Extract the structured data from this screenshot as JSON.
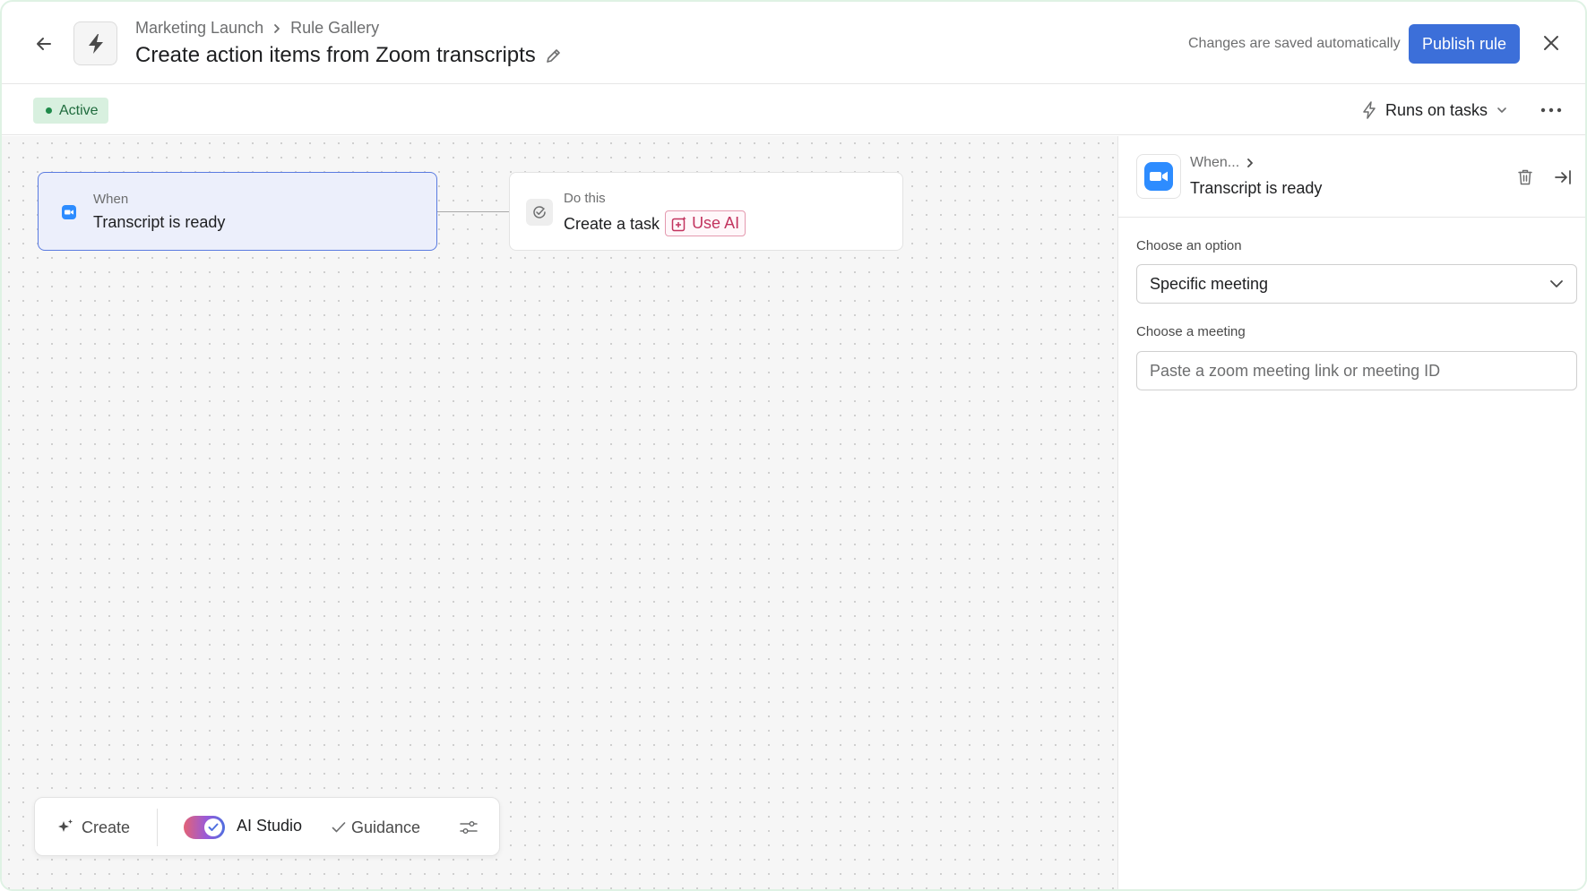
{
  "header": {
    "breadcrumb": [
      "Marketing Launch",
      "Rule Gallery"
    ],
    "title": "Create action items from Zoom transcripts",
    "saved_status": "Changes are saved automatically",
    "publish_label": "Publish rule"
  },
  "subheader": {
    "status": "Active",
    "runs_on": "Runs on tasks"
  },
  "canvas": {
    "trigger": {
      "kicker": "When",
      "title": "Transcript is ready",
      "icon": "zoom-icon"
    },
    "action": {
      "kicker": "Do this",
      "title": "Create a task",
      "ai_label": "Use AI",
      "icon": "task-check-icon"
    }
  },
  "toolbar": {
    "create_label": "Create",
    "ai_studio_label": "AI Studio",
    "ai_studio_enabled": true,
    "guidance_label": "Guidance"
  },
  "panel": {
    "when_label": "When...",
    "trigger_title": "Transcript is ready",
    "option_label": "Choose an option",
    "option_value": "Specific meeting",
    "meeting_label": "Choose a meeting",
    "meeting_placeholder": "Paste a zoom meeting link or meeting ID",
    "meeting_value": ""
  },
  "colors": {
    "primary": "#3c6fd9",
    "status_bg": "#d8f0df",
    "status_text": "#1f6b3d",
    "zoom_blue": "#2d8cff",
    "ai_accent": "#c2345f",
    "selected_node_bg": "#eceffb",
    "selected_node_border": "#5a7be0"
  }
}
